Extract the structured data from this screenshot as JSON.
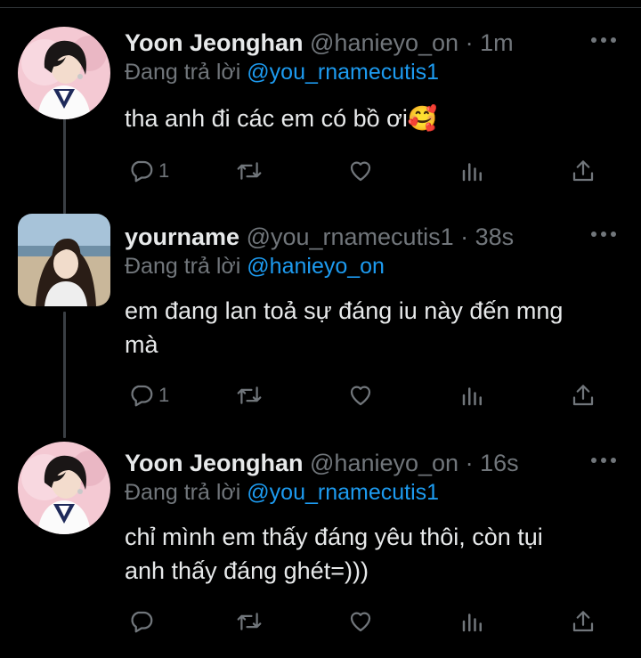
{
  "tweets": [
    {
      "name": "Yoon Jeonghan",
      "handle": "@hanieyo_on",
      "dot": "·",
      "time": "1m",
      "reply_prefix": "Đang trả lời",
      "reply_mention": "@you_rnamecutis1",
      "text_lines": [
        "tha anh đi các em có bồ ơi🥰"
      ],
      "reply_count": "1",
      "avatar": "jeonghan-avatar"
    },
    {
      "name": "yourname",
      "handle": "@you_rnamecutis1",
      "dot": "·",
      "time": "38s",
      "reply_prefix": "Đang trả lời",
      "reply_mention": "@hanieyo_on",
      "text_lines": [
        "em đang lan toả sự đáng iu này đến mng",
        "mà"
      ],
      "reply_count": "1",
      "avatar": "yourname-avatar"
    },
    {
      "name": "Yoon Jeonghan",
      "handle": "@hanieyo_on",
      "dot": "·",
      "time": "16s",
      "reply_prefix": "Đang trả lời",
      "reply_mention": "@you_rnamecutis1",
      "text_lines": [
        "chỉ mình em thấy đáng yêu thôi, còn tụi",
        "anh thấy đáng ghét=)))"
      ],
      "reply_count": "",
      "avatar": "jeonghan-avatar"
    }
  ],
  "icons": {
    "reply": "reply-icon",
    "retweet": "retweet-icon",
    "like": "heart-icon",
    "views": "views-icon",
    "share": "share-icon",
    "more": "more-icon"
  },
  "colors": {
    "background": "#000000",
    "text": "#e7e9ea",
    "muted": "#71767b",
    "mention": "#1d9bf0",
    "divider": "#2f3336"
  }
}
